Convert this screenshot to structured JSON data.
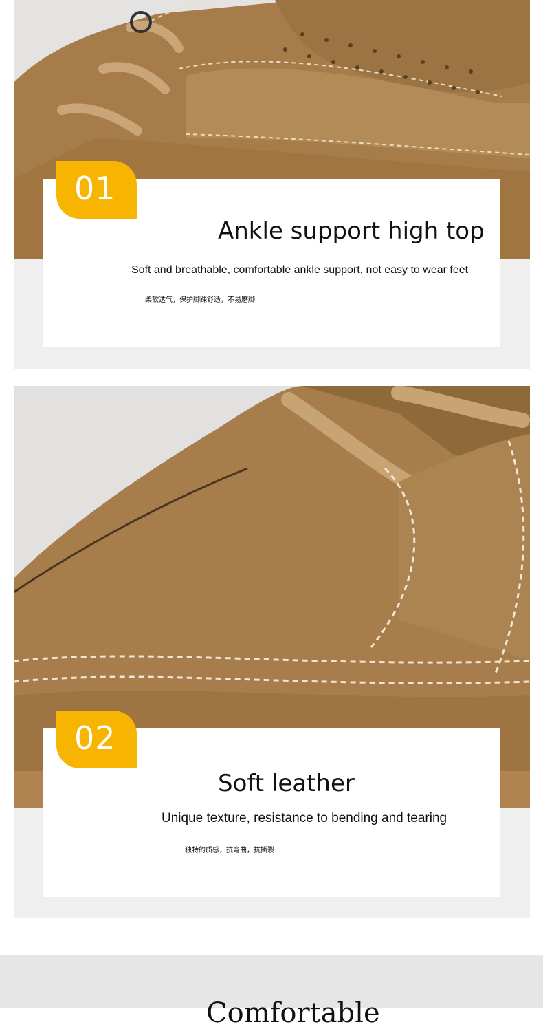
{
  "features": [
    {
      "number": "01",
      "title": "Ankle support high top",
      "subtitle": "Soft and breathable, comfortable ankle support, not easy to wear feet",
      "subtitle_cn": "柔软透气，保护脚踝舒适，不易磨脚"
    },
    {
      "number": "02",
      "title": "Soft leather",
      "subtitle": "Unique texture, resistance to bending and tearing",
      "subtitle_cn": "独特的质感，抗弯曲，抗撕裂"
    }
  ],
  "next_section": {
    "title": "Comfortable"
  },
  "colors": {
    "badge": "#f7b400",
    "panel": "#efefef",
    "card": "#ffffff",
    "suede": "#a9814f",
    "stitch": "#f1e6d3"
  }
}
